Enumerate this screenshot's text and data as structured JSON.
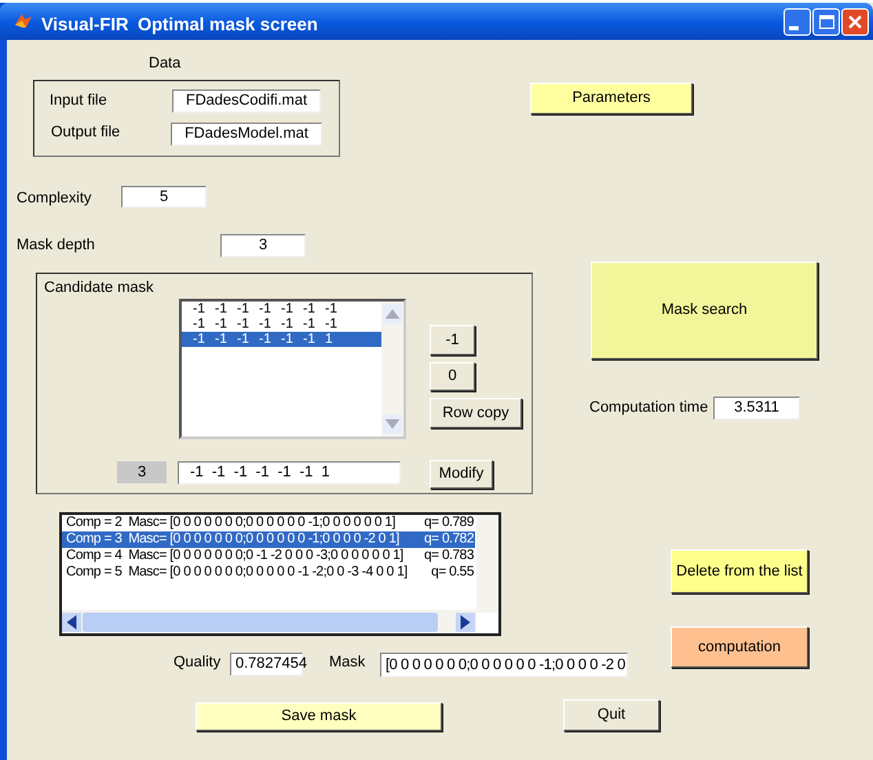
{
  "window": {
    "app_name": "Visual-FIR",
    "title": "Optimal mask screen"
  },
  "data": {
    "heading": "Data",
    "input_file": {
      "label": "Input file",
      "value": "FDadesCodifi.mat"
    },
    "output_file": {
      "label": "Output file",
      "value": "FDadesModel.mat"
    }
  },
  "parameters_button": {
    "label": "Parameters",
    "color": "#ffffa0"
  },
  "complexity": {
    "label": "Complexity",
    "value": "5"
  },
  "mask_depth": {
    "label": "Mask depth",
    "value": "3"
  },
  "candidate_mask": {
    "title": "Candidate mask",
    "rows": [
      {
        "cells": [
          "-1",
          "-1",
          "-1",
          "-1",
          "-1",
          "-1",
          "-1"
        ],
        "selected": false
      },
      {
        "cells": [
          "-1",
          "-1",
          "-1",
          "-1",
          "-1",
          "-1",
          "-1"
        ],
        "selected": false
      },
      {
        "cells": [
          "-1",
          "-1",
          "-1",
          "-1",
          "-1",
          "-1",
          "1"
        ],
        "selected": true
      }
    ],
    "buttons": [
      {
        "label": "-1"
      },
      {
        "label": "0"
      },
      {
        "label": "Row copy"
      }
    ],
    "row_number": "3",
    "row_value": "-1  -1  -1  -1  -1  -1  1",
    "modify_button": "Modify"
  },
  "mask_search_button": {
    "label": "Mask search",
    "color": "#f2f59a"
  },
  "computation_time": {
    "label": "Computation time",
    "value": "3.5311"
  },
  "results": [
    {
      "mask": "Comp = 2  Masc= [0 0 0 0 0 0 0;0 0 0 0 0 0 -1;0 0 0 0 0 0 1]",
      "quality": "q= 0.789",
      "selected": false
    },
    {
      "mask": "Comp = 3  Masc= [0 0 0 0 0 0 0;0 0 0 0 0 0 -1;0 0 0 0 -2 0 1]",
      "quality": "q= 0.782",
      "selected": true
    },
    {
      "mask": "Comp = 4  Masc= [0 0 0 0 0 0 0;0 -1 -2 0 0 0 -3;0 0 0 0 0 0 1]",
      "quality": "q= 0.783",
      "selected": false
    },
    {
      "mask": "Comp = 5  Masc= [0 0 0 0 0 0 0;0 0 0 0 0 -1 -2;0 0 -3 -4 0 0 1]",
      "quality": "q= 0.55",
      "selected": false
    }
  ],
  "delete_button": {
    "label": "Delete from the list",
    "color": "#ffff8c"
  },
  "computation_button": {
    "label": "computation",
    "color": "#ffc090"
  },
  "quality": {
    "label": "Quality",
    "value": "0.7827454"
  },
  "mask": {
    "label": "Mask",
    "value": "[0 0 0 0 0 0 0;0 0 0 0 0 0 -1;0 0 0 0 -2 0"
  },
  "save_button": {
    "label": "Save mask",
    "color": "#ffffc0"
  },
  "quit_button": {
    "label": "Quit"
  }
}
